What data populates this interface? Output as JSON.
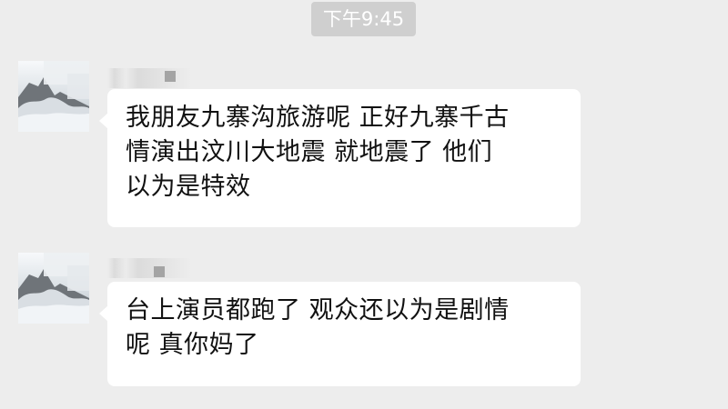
{
  "timestamp": "下午9:45",
  "messages": [
    {
      "avatar_icon": "misty-mountain-avatar-icon",
      "lines": [
        "我朋友九寨沟旅游呢 正好九寨千古",
        "情演出汶川大地震 就地震了 他们",
        "以为是特效"
      ]
    },
    {
      "avatar_icon": "misty-mountain-avatar-icon",
      "lines": [
        "台上演员都跑了 观众还以为是剧情",
        "呢 真你妈了"
      ]
    }
  ],
  "colors": {
    "background": "#ededed",
    "bubble": "#ffffff",
    "timestamp_pill": "#cfcfcf"
  }
}
